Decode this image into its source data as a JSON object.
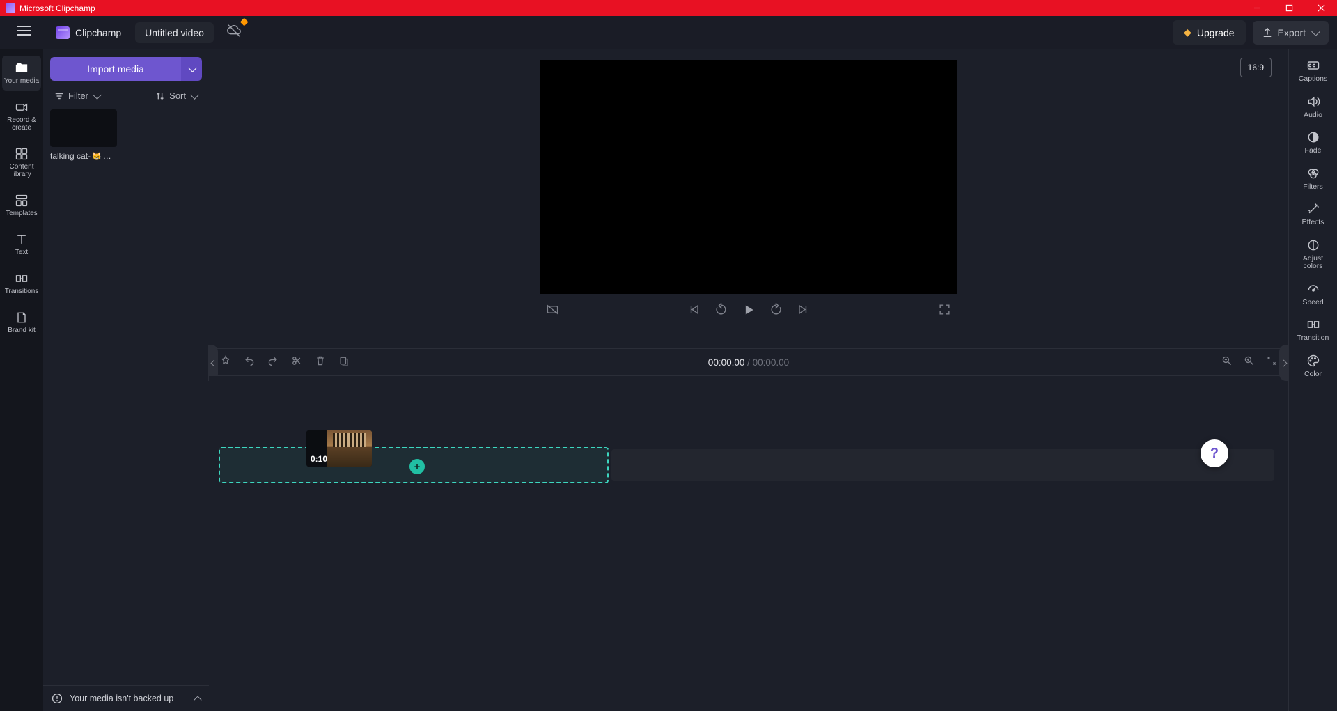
{
  "window": {
    "title": "Microsoft Clipchamp"
  },
  "topbar": {
    "brand": "Clipchamp",
    "project_title": "Untitled video",
    "upgrade_label": "Upgrade",
    "export_label": "Export"
  },
  "left_nav": {
    "your_media": "Your media",
    "record_create": "Record & create",
    "content_library": "Content library",
    "templates": "Templates",
    "text": "Text",
    "transitions": "Transitions",
    "brand_kit": "Brand kit"
  },
  "side_panel": {
    "import_label": "Import media",
    "filter_label": "Filter",
    "sort_label": "Sort",
    "media_item_label": "talking cat-",
    "media_item_suffix": "…",
    "backup_msg": "Your media isn't backed up"
  },
  "preview": {
    "aspect_ratio": "16:9"
  },
  "timeline": {
    "time_current": "00:00.00",
    "time_separator": " / ",
    "time_duration": "00:00.00",
    "clip_duration": "0:10",
    "add_symbol": "+"
  },
  "right_nav": {
    "captions": "Captions",
    "audio": "Audio",
    "fade": "Fade",
    "filters": "Filters",
    "effects": "Effects",
    "adjust_colors": "Adjust colors",
    "speed": "Speed",
    "transition": "Transition",
    "color": "Color"
  },
  "help": {
    "symbol": "?"
  }
}
